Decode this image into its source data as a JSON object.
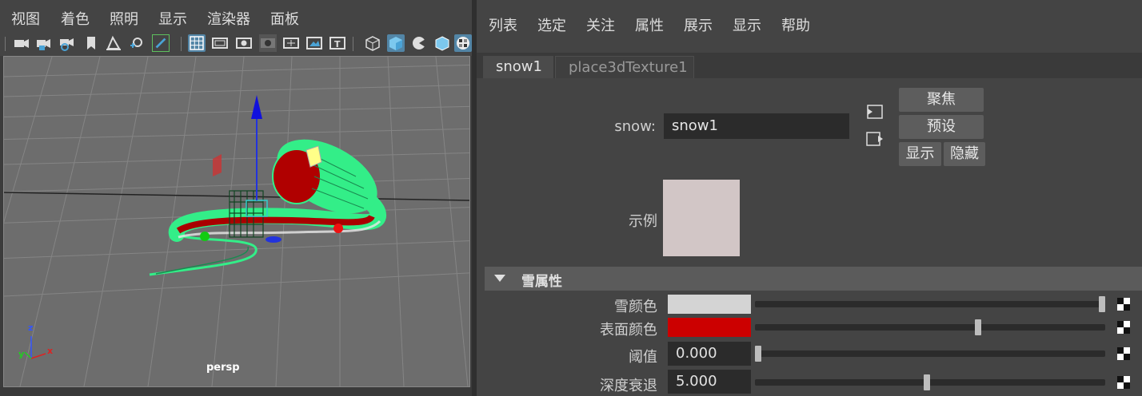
{
  "viewport_panel": {
    "menu": [
      "视图",
      "着色",
      "照明",
      "显示",
      "渲染器",
      "面板"
    ],
    "camera": "persp",
    "axis": {
      "x": "x",
      "y": "y",
      "z": "z"
    }
  },
  "attribute_editor": {
    "menu": [
      "列表",
      "选定",
      "关注",
      "属性",
      "展示",
      "显示",
      "帮助"
    ],
    "tabs": [
      "snow1",
      "place3dTexture1"
    ],
    "node_label": "snow:",
    "node_name": "snow1",
    "buttons": {
      "focus": "聚焦",
      "presets": "预设",
      "show": "显示",
      "hide": "隐藏"
    },
    "sample_label": "示例",
    "sample_color": "#d2c6c6",
    "section_title": "雪属性",
    "attributes": [
      {
        "label": "雪颜色",
        "type": "color",
        "color": "#d4d4d4",
        "slider": 1.0
      },
      {
        "label": "表面颜色",
        "type": "color",
        "color": "#cc0000",
        "slider": 0.64
      },
      {
        "label": "阈值",
        "type": "number",
        "value": "0.000",
        "slider": 0.0
      },
      {
        "label": "深度衰退",
        "type": "number",
        "value": "5.000",
        "slider": 0.49
      }
    ]
  },
  "colors": {
    "accent": "#5285a6",
    "panel": "#444444",
    "field": "#2b2b2b"
  }
}
